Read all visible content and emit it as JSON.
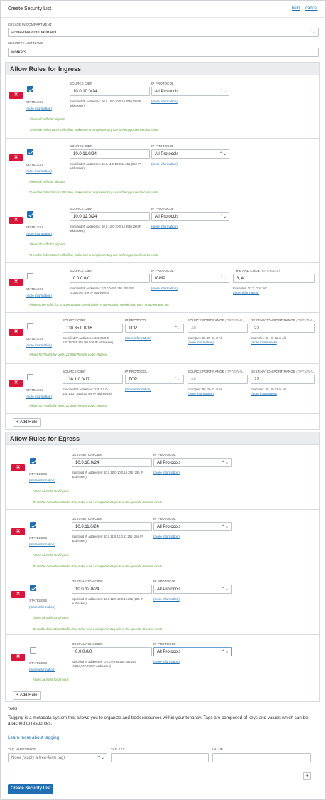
{
  "dialog": {
    "title": "Create Security List",
    "help_label": "help",
    "cancel_label": "cancel"
  },
  "compartment": {
    "label": "CREATE IN COMPARTMENT",
    "value": "acme-dev-compartment"
  },
  "name": {
    "label": "SECURITY LIST NAME",
    "value": "workers"
  },
  "labels": {
    "stateless": "STATELESS",
    "more_info": "(more information)",
    "source_cidr": "SOURCE CIDR",
    "destination_cidr": "DESTINATION CIDR",
    "ip_protocol": "IP PROTOCOL",
    "type_and_code": "TYPE AND CODE",
    "source_port_range": "SOURCE PORT RANGE",
    "destination_port_range": "DESTINATION PORT RANGE",
    "optional": "(OPTIONAL)",
    "bidirectional_note": "To enable bidirectional traffic flow, make sure a complementary rule in the opposite direction exists."
  },
  "ingress": {
    "title": "Allow Rules for Ingress",
    "add_rule_label": "+ Add Rule",
    "rules": [
      {
        "stateless": true,
        "cidr": "10.0.10.0/24",
        "cidr_help": "Specified IP addresses: 10.0.10.0-10.0.10.255 (256 IP addresses)",
        "protocol": "All Protocols",
        "traffic_note": "Allows all traffic for all ports"
      },
      {
        "stateless": true,
        "cidr": "10.0.11.0/24",
        "cidr_help": "Specified IP addresses: 10.0.11.0-10.0.11.255 (256 IP addresses)",
        "protocol": "All Protocols",
        "traffic_note": "Allows all traffic for all ports"
      },
      {
        "stateless": true,
        "cidr": "10.0.12.0/24",
        "cidr_help": "Specified IP addresses: 10.0.12.0-10.0.12.255 (256 IP addresses)",
        "protocol": "All Protocols",
        "traffic_note": "Allows all traffic for all ports"
      },
      {
        "stateless": false,
        "cidr": "0.0.0.0/0",
        "cidr_help": "Specified IP addresses: 0.0.0.0-255.255.255.255 (4,294,967,296 IP addresses)",
        "protocol": "ICMP",
        "type_code": "3, 4",
        "type_code_help": "Examples: '8', '3, 0' or 'All'",
        "traffic_note": "Allows ICMP traffic for: 3, 4 Destination Unreachable: Fragmentation Needed and Don't Fragment was Set"
      },
      {
        "stateless": false,
        "cidr": "130.35.0.0/16",
        "cidr_help": "Specified IP addresses: 130.35.0.0-130.35.255.255 (65,536 IP addresses)",
        "protocol": "TCP",
        "src_port_placeholder": "All",
        "src_port_help": "Examples: 80, 20-22 or All",
        "dst_port": "22",
        "dst_port_help": "Examples: 80, 20-22 or All",
        "traffic_note": "Allows TCP traffic for ports: 22 SSH Remote Login Protocol"
      },
      {
        "stateless": false,
        "cidr": "138.1.0.0/17",
        "cidr_help": "Specified IP addresses: 138.1.0.0-138.1.127.255 (32,768 IP addresses)",
        "protocol": "TCP",
        "src_port_placeholder": "All",
        "src_port_help": "Examples: 80, 20-22 or All",
        "dst_port": "22",
        "dst_port_help": "Examples: 80, 20-22 or All",
        "traffic_note": "Allows TCP traffic for ports: 22 SSH Remote Login Protocol"
      }
    ]
  },
  "egress": {
    "title": "Allow Rules for Egress",
    "add_rule_label": "+ Add Rule",
    "rules": [
      {
        "stateless": true,
        "cidr": "10.0.10.0/24",
        "cidr_help": "Specified IP addresses: 10.0.10.0-10.0.10.255 (256 IP addresses)",
        "protocol": "All Protocols",
        "traffic_note": "Allows all traffic for all ports"
      },
      {
        "stateless": true,
        "cidr": "10.0.11.0/24",
        "cidr_help": "Specified IP addresses: 10.0.11.0-10.0.11.255 (256 IP addresses)",
        "protocol": "All Protocols",
        "traffic_note": "Allows all traffic for all ports"
      },
      {
        "stateless": true,
        "cidr": "10.0.12.0/24",
        "cidr_help": "Specified IP addresses: 10.0.12.0-10.0.12.255 (256 IP addresses)",
        "protocol": "All Protocols",
        "traffic_note": "Allows all traffic for all ports"
      },
      {
        "stateless": false,
        "cidr": "0.0.0.0/0",
        "cidr_help": "Specified IP addresses: 0.0.0.0-255.255.255.255 (4,294,967,296 IP addresses)",
        "protocol": "All Protocols",
        "traffic_note": "Allows all traffic for all ports"
      }
    ]
  },
  "tags": {
    "title": "TAGS",
    "description": "Tagging is a metadata system that allows you to organize and track resources within your tenancy. Tags are composed of keys and values which can be attached to resources.",
    "learn_more": "Learn more about tagging",
    "namespace_label": "TAG NAMESPACE",
    "namespace_value": "None (apply a free-form tag)",
    "key_label": "TAG KEY",
    "value_label": "VALUE",
    "add_label": "+"
  },
  "create_button": "Create Security List",
  "icons": {
    "remove": "close-icon",
    "dropdown": "chevron-down-icon",
    "checkbox": "check-icon"
  },
  "colors": {
    "danger": "#d9163a",
    "primary": "#1f6fb2",
    "note_green": "#5a9e2f"
  }
}
